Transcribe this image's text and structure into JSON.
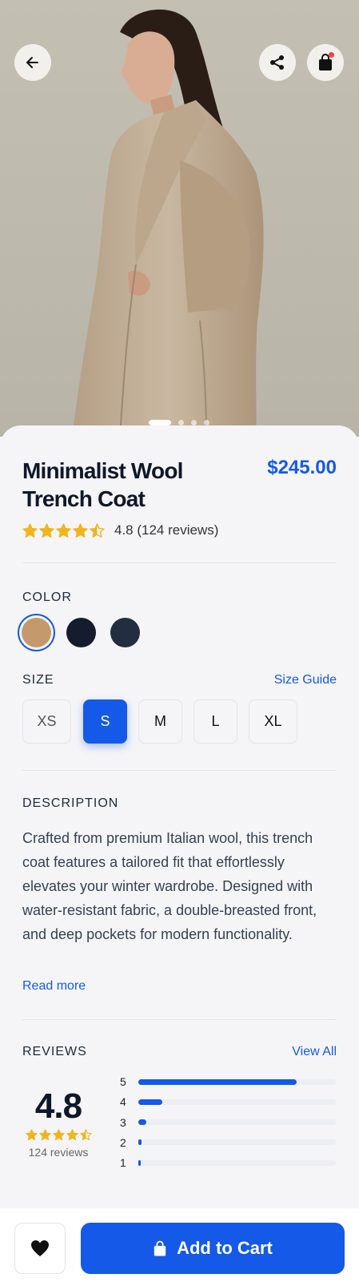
{
  "hero": {
    "image_count": 4,
    "active_index": 0
  },
  "toolbar": {
    "back_icon": "arrow-left-icon",
    "share_icon": "share-icon",
    "bag_icon": "shopping-bag-icon",
    "bag_has_notification": true
  },
  "product": {
    "name": "Minimalist Wool Trench Coat",
    "price": "$245.00",
    "rating": 4.5,
    "rating_text": "4.8 (124 reviews)"
  },
  "color": {
    "label": "COLOR",
    "options": [
      {
        "hex": "#c49a6c",
        "selected": true
      },
      {
        "hex": "#141c2e",
        "selected": false
      },
      {
        "hex": "#222d42",
        "selected": false
      }
    ]
  },
  "size": {
    "label": "SIZE",
    "guide_link": "Size Guide",
    "options": [
      "XS",
      "S",
      "M",
      "L",
      "XL"
    ],
    "selected": "S"
  },
  "description": {
    "label": "DESCRIPTION",
    "text": "Crafted from premium Italian wool, this trench coat features a tailored fit that effortlessly elevates your winter wardrobe. Designed with water-resistant fabric, a double-breasted front, and deep pockets for modern functionality.",
    "read_more": "Read more"
  },
  "reviews": {
    "label": "REVIEWS",
    "view_all": "View All",
    "average": "4.8",
    "count_text": "124 reviews",
    "breakdown": [
      {
        "stars": "5",
        "fraction": 0.8
      },
      {
        "stars": "4",
        "fraction": 0.12
      },
      {
        "stars": "3",
        "fraction": 0.04
      },
      {
        "stars": "2",
        "fraction": 0.015
      },
      {
        "stars": "1",
        "fraction": 0.008
      }
    ]
  },
  "actions": {
    "wishlist_icon": "heart-icon",
    "cart_icon": "shopping-bag-icon",
    "add_to_cart": "Add to Cart"
  },
  "colors": {
    "accent": "#1459e8",
    "star": "#f0b51e",
    "background": "#f5f5f7"
  }
}
